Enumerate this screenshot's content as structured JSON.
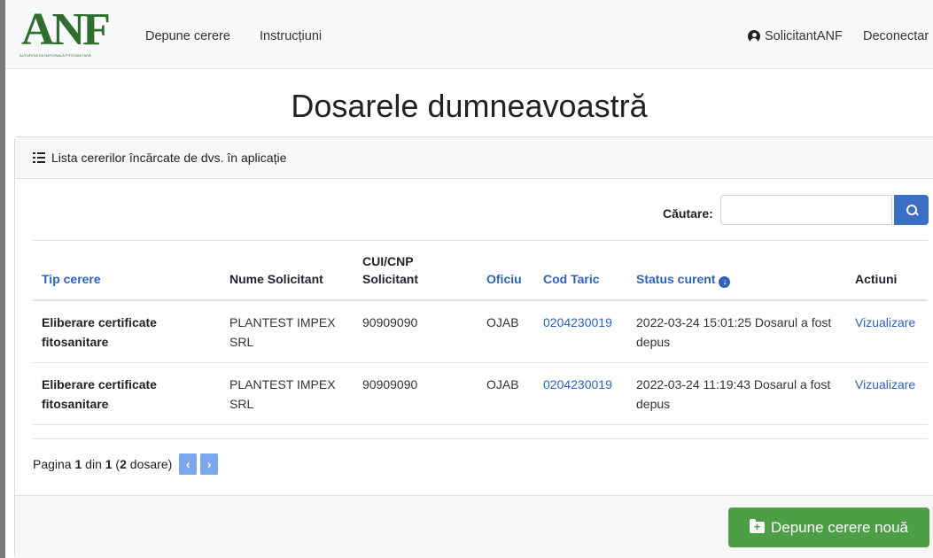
{
  "navbar": {
    "logo_text": "ANF",
    "logo_tagline": "AUTORITATEA NAȚIONALĂ FITOSANITARĂ",
    "links": [
      "Depune cerere",
      "Instrucțiuni"
    ],
    "user_label": "SolicitantANF",
    "logout_label": "Deconectar"
  },
  "page": {
    "title": "Dosarele dumneavoastră"
  },
  "card": {
    "header": "Lista cererilor încărcate de dvs. în aplicație",
    "search": {
      "label": "Căutare:",
      "value": ""
    },
    "columns": [
      "Tip cerere",
      "Nume Solicitant",
      "CUI/CNP Solicitant",
      "Oficiu",
      "Cod Taric",
      "Status curent",
      "Actiuni"
    ],
    "rows": [
      {
        "tip": "Eliberare certificate fitosanitare",
        "nume": "PLANTEST IMPEX SRL",
        "cui": "90909090",
        "oficiu": "OJAB",
        "cod": "0204230019",
        "status": "2022-03-24 15:01:25 Dosarul a fost depus",
        "action": "Vizualizare"
      },
      {
        "tip": "Eliberare certificate fitosanitare",
        "nume": "PLANTEST IMPEX SRL",
        "cui": "90909090",
        "oficiu": "OJAB",
        "cod": "0204230019",
        "status": "2022-03-24 11:19:43 Dosarul a fost depus",
        "action": "Vizualizare"
      }
    ],
    "pagination": {
      "prefix": "Pagina",
      "current": "1",
      "of": "din",
      "total": "1",
      "count": "2",
      "suffix": "dosare)"
    },
    "new_button": "Depune cerere nouă"
  },
  "colors": {
    "primary": "#3a6fc6",
    "link": "#2f63b8",
    "success": "#4c9f44",
    "logo": "#2f6e2f"
  }
}
